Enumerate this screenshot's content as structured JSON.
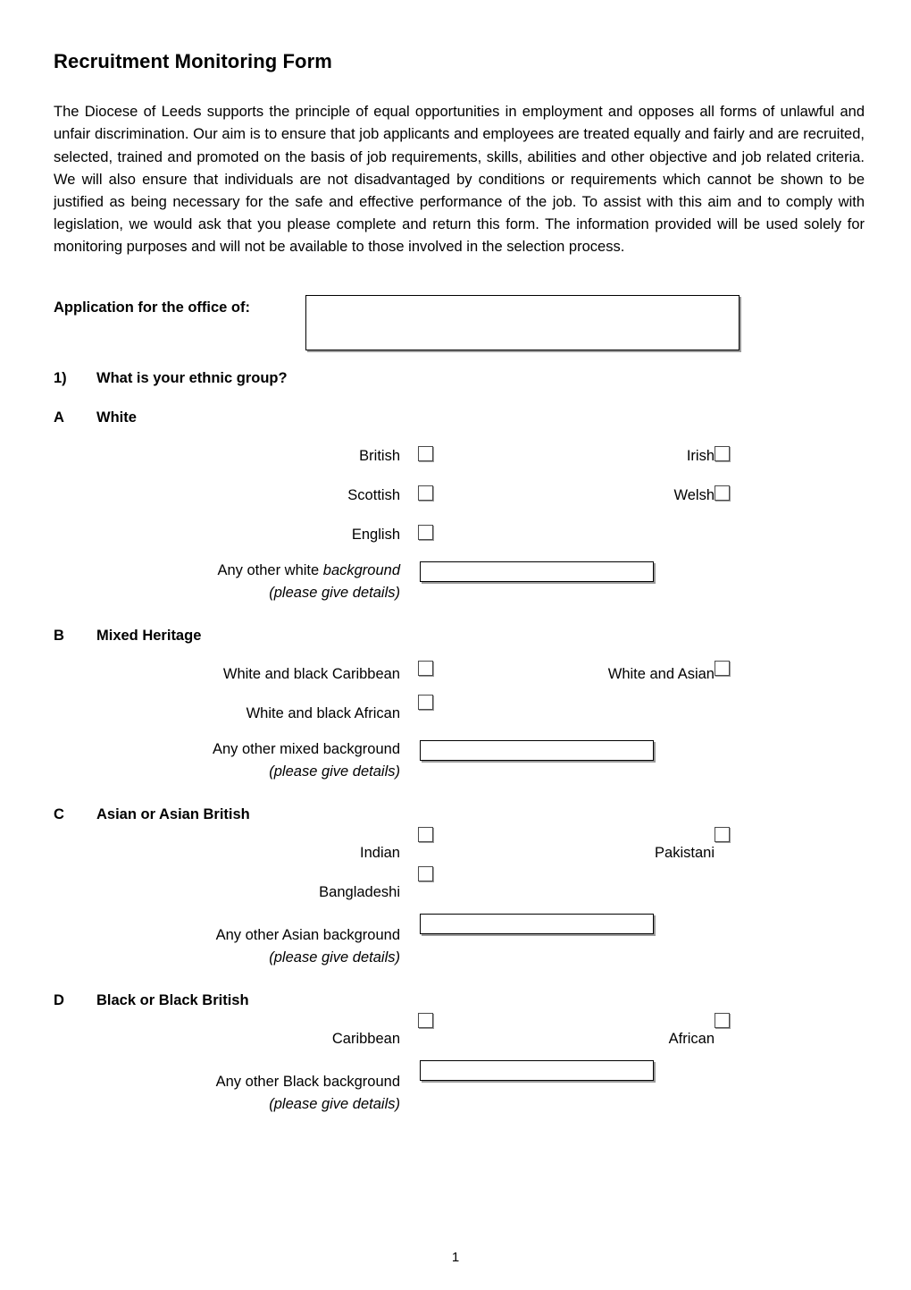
{
  "document": {
    "title": "Recruitment Monitoring Form",
    "intro": "The Diocese of Leeds supports the principle of equal opportunities in employment and opposes all forms of unlawful and unfair discrimination.  Our aim is to ensure that job applicants and employees are treated equally and fairly and are recruited, selected, trained and promoted on the basis of job requirements, skills, abilities and other objective and job related criteria.  We will also ensure that individuals are not disadvantaged by conditions or requirements which cannot be shown to be justified as being necessary for the safe and effective performance of the job.  To assist with this aim and to comply with legislation, we would ask that you please complete and return this form.  The information provided will be used solely for monitoring purposes and will not be available to those involved in the selection process.",
    "page_number": "1"
  },
  "office": {
    "label": "Application for the office of:",
    "value": "",
    "placeholder": ""
  },
  "question": {
    "number": "1)",
    "text": "What is your ethnic group?"
  },
  "sections": {
    "a": {
      "letter": "A",
      "name": "White",
      "options": [
        {
          "label": "British",
          "value": ""
        },
        {
          "label": "Irish",
          "value": ""
        },
        {
          "label": "Scottish",
          "value": ""
        },
        {
          "label": "Welsh",
          "value": ""
        },
        {
          "label": "English",
          "value": ""
        }
      ],
      "other": {
        "line1_plain": "Any other white ",
        "line1_italic": "background",
        "line2": "(please give details)",
        "value": "",
        "placeholder": ""
      }
    },
    "b": {
      "letter": "B",
      "name": "Mixed Heritage",
      "options": [
        {
          "label": "White and black Caribbean",
          "value": ""
        },
        {
          "label": "White and Asian",
          "value": ""
        },
        {
          "label": "White and black African",
          "value": ""
        }
      ],
      "other": {
        "line1_plain": "Any other mixed background",
        "line1_italic": "",
        "line2": "(please give details)",
        "value": "",
        "placeholder": ""
      }
    },
    "c": {
      "letter": "C",
      "name": "Asian or Asian British",
      "options": [
        {
          "label": "Indian",
          "value": ""
        },
        {
          "label": "Pakistani",
          "value": ""
        },
        {
          "label": "Bangladeshi",
          "value": ""
        }
      ],
      "other": {
        "line1_plain": "Any other Asian background",
        "line1_italic": "",
        "line2": "(please give details)",
        "value": "",
        "placeholder": ""
      }
    },
    "d": {
      "letter": "D",
      "name": "Black or Black British",
      "options": [
        {
          "label": "Caribbean",
          "value": ""
        },
        {
          "label": "African",
          "value": ""
        }
      ],
      "other": {
        "line1_plain": "Any other Black background",
        "line1_italic": "",
        "line2": "(please give details)",
        "value": "",
        "placeholder": ""
      }
    }
  }
}
